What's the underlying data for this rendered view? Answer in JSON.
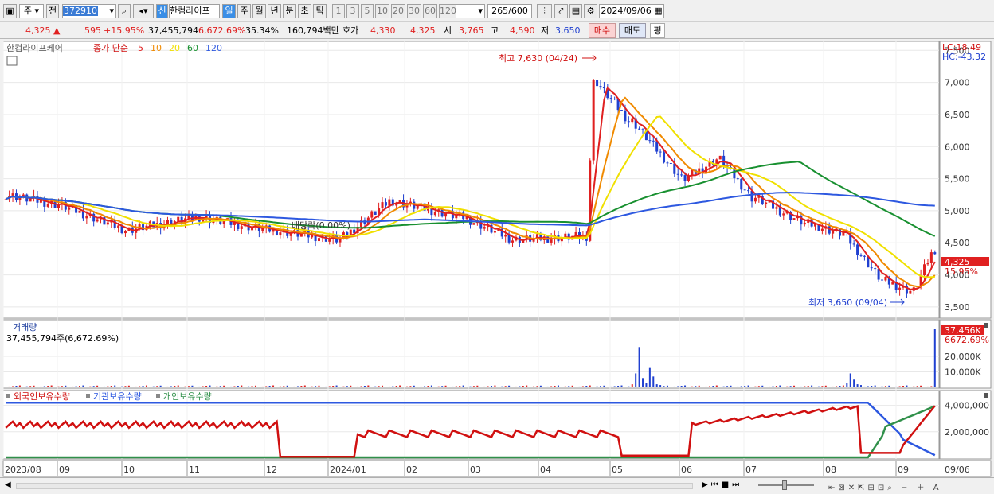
{
  "toolbar": {
    "market": "주",
    "prev": "전",
    "code": "372910",
    "shin": "신",
    "stock_name": "한컴라이프",
    "periods": [
      "일",
      "주",
      "월",
      "년",
      "분",
      "초",
      "틱"
    ],
    "active_period": "일",
    "intervals": [
      "1",
      "3",
      "5",
      "10",
      "20",
      "30",
      "60",
      "120"
    ],
    "count": "265",
    "count_total": "/600",
    "date": "2024/09/06"
  },
  "quote": {
    "price": "4,325",
    "change": "595",
    "rate": "+15.95%",
    "volume": "37,455,794",
    "vol_rate": "6,672.69%",
    "turnover": "35.34%",
    "amount": "160,794백만",
    "bid_label": "호가",
    "bid1": "4,330",
    "bid2": "4,325",
    "open_label": "시",
    "open": "3,765",
    "high_label": "고",
    "high": "4,590",
    "low_label": "저",
    "low": "3,650",
    "buy": "매수",
    "sell": "매도",
    "avg": "평"
  },
  "price_panel": {
    "legend_name": "한컴라이프케어",
    "legend_type": "종가 단순",
    "ma": [
      {
        "p": "5",
        "c": "#e02020"
      },
      {
        "p": "10",
        "c": "#f08a00"
      },
      {
        "p": "20",
        "c": "#f0e000"
      },
      {
        "p": "60",
        "c": "#189030"
      },
      {
        "p": "120",
        "c": "#2d58e0"
      }
    ],
    "lc": "LC:18.49",
    "hc": "HC:-43.32",
    "yticks": [
      "7,500",
      "7,000",
      "6,500",
      "6,000",
      "5,500",
      "5,000",
      "4,500",
      "4,000",
      "3,500"
    ],
    "high_note": "최고 7,630 (04/24)",
    "low_note": "최저 3,650 (09/04)",
    "dividend": "배당락(0.00%)",
    "price_tag": "4,325",
    "rate_tag": "15.95%"
  },
  "volume_panel": {
    "title": "거래량",
    "info": "37,455,794주(6,672.69%)",
    "tag": "37,456K",
    "tag2": "6672.69%",
    "yticks": [
      "20,000K",
      "10,000K"
    ]
  },
  "holding_panel": {
    "legend": [
      "외국인보유수량",
      "기관보유수량",
      "개인보유수량"
    ],
    "yticks": [
      "4,000,000",
      "2,000,000"
    ]
  },
  "xaxis": [
    "2023/08",
    "09",
    "10",
    "11",
    "12",
    "2024/01",
    "02",
    "03",
    "04",
    "05",
    "06",
    "07",
    "08",
    "09",
    "09/06"
  ],
  "colors": {
    "up": "#e02020",
    "down": "#2040d0",
    "foreign": "#d01010",
    "inst": "#2d58e0",
    "indiv": "#30904a"
  }
}
